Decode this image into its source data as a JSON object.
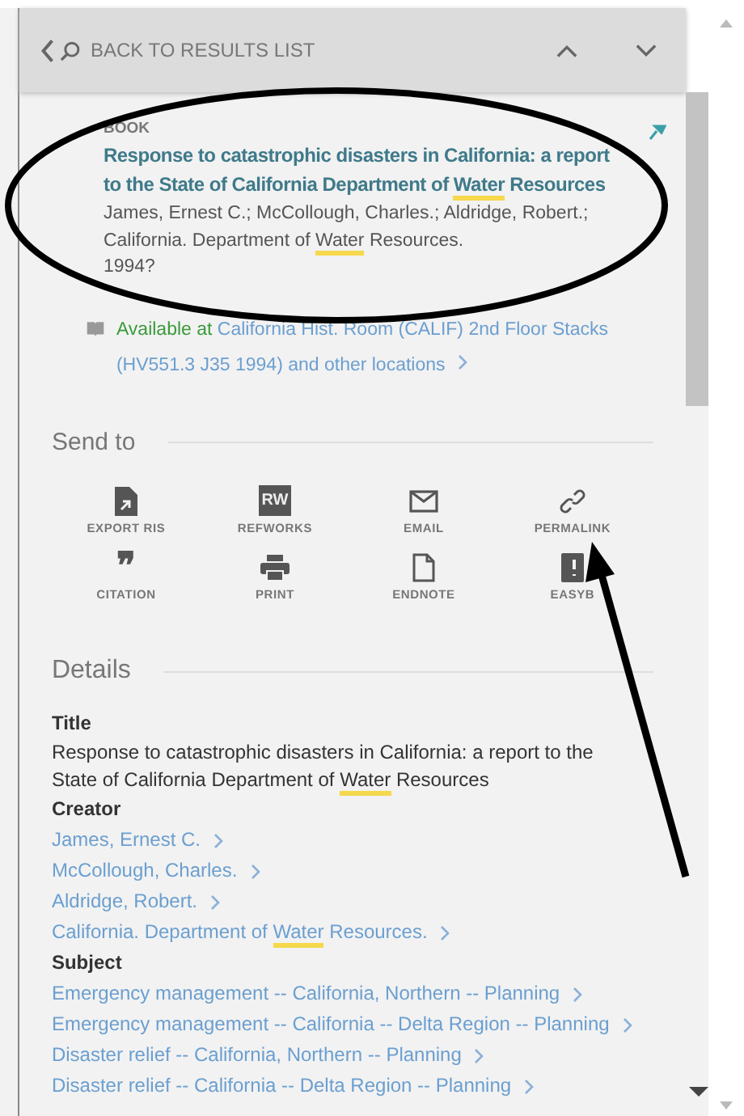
{
  "header": {
    "back_label": "BACK TO RESULTS LIST"
  },
  "record": {
    "type": "BOOK",
    "title": [
      {
        "text": "Response to catastrophic disasters in California: a report to the State of California Department of ",
        "highlighted": false
      },
      {
        "text": "Water",
        "highlighted": true
      },
      {
        "text": " Resources",
        "highlighted": false
      }
    ],
    "authors": [
      {
        "text": "James, Ernest C.; McCollough, Charles.; Aldridge, Robert.; California. Department of ",
        "highlighted": false
      },
      {
        "text": "Water",
        "highlighted": true
      },
      {
        "text": " Resources.",
        "highlighted": false
      }
    ],
    "date": "1994?",
    "availability": {
      "status": "Available at",
      "location": "California Hist. Room (CALIF)  2nd Floor Stacks (HV551.3 J35 1994) and other locations"
    }
  },
  "send_to": {
    "heading": "Send to",
    "actions": [
      {
        "label": "EXPORT RIS",
        "kind": "export"
      },
      {
        "label": "REFWORKS",
        "kind": "refworks",
        "badge": "RW"
      },
      {
        "label": "EMAIL",
        "kind": "email"
      },
      {
        "label": "PERMALINK",
        "kind": "link"
      },
      {
        "label": "CITATION",
        "kind": "citation",
        "badge": "❞"
      },
      {
        "label": "PRINT",
        "kind": "print"
      },
      {
        "label": "ENDNOTE",
        "kind": "endnote"
      },
      {
        "label": "EASYB",
        "kind": "easybib"
      }
    ]
  },
  "details": {
    "heading": "Details",
    "fields": [
      {
        "label": "Title",
        "kind": "text",
        "value": [
          {
            "text": "Response to catastrophic disasters in California: a report to the State of California Department of ",
            "highlighted": false
          },
          {
            "text": "Water",
            "highlighted": true
          },
          {
            "text": " Resources",
            "highlighted": false
          }
        ]
      },
      {
        "label": "Creator",
        "kind": "links",
        "links": [
          [
            {
              "text": "James, Ernest C.",
              "highlighted": false
            }
          ],
          [
            {
              "text": "McCollough, Charles.",
              "highlighted": false
            }
          ],
          [
            {
              "text": "Aldridge, Robert.",
              "highlighted": false
            }
          ],
          [
            {
              "text": "California. Department of ",
              "highlighted": false
            },
            {
              "text": "Water",
              "highlighted": true
            },
            {
              "text": " Resources.",
              "highlighted": false
            }
          ]
        ]
      },
      {
        "label": "Subject",
        "kind": "links",
        "links": [
          [
            {
              "text": "Emergency management -- California, Northern -- Planning",
              "highlighted": false
            }
          ],
          [
            {
              "text": "Emergency management -- California -- Delta Region -- Planning",
              "highlighted": false
            }
          ],
          [
            {
              "text": "Disaster relief -- California, Northern -- Planning",
              "highlighted": false
            }
          ],
          [
            {
              "text": "Disaster relief -- California -- Delta Region -- Planning",
              "highlighted": false
            }
          ]
        ]
      }
    ]
  }
}
